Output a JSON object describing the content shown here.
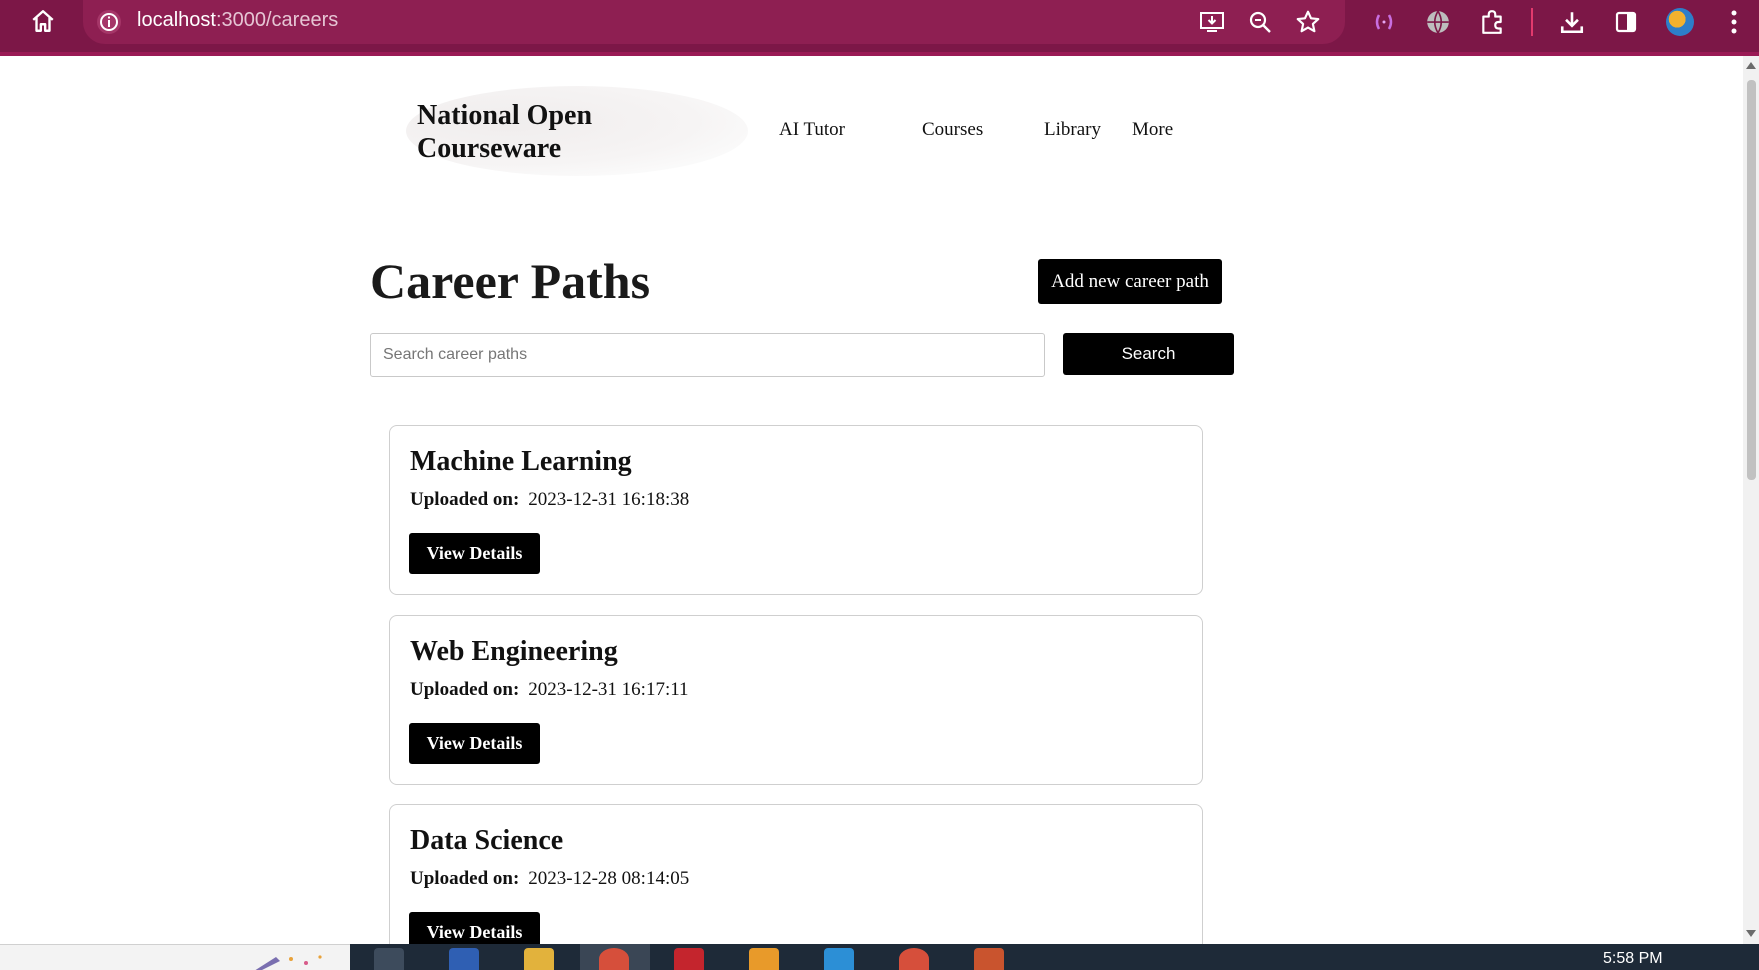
{
  "browser": {
    "url_host": "localhost",
    "url_path": ":3000/careers"
  },
  "site": {
    "brand_line1": "National Open",
    "brand_line2": "Courseware",
    "nav": [
      "AI Tutor",
      "Courses",
      "Library",
      "More"
    ]
  },
  "page": {
    "title": "Career Paths",
    "add_button": "Add new career path",
    "search_placeholder": "Search career paths",
    "search_button": "Search"
  },
  "careers": [
    {
      "title": "Machine Learning",
      "uploaded_label": "Uploaded on:",
      "uploaded_on": "2023-12-31 16:18:38",
      "button": "View Details"
    },
    {
      "title": "Web Engineering",
      "uploaded_label": "Uploaded on:",
      "uploaded_on": "2023-12-31 16:17:11",
      "button": "View Details"
    },
    {
      "title": "Data Science",
      "uploaded_label": "Uploaded on:",
      "uploaded_on": "2023-12-28 08:14:05",
      "button": "View Details"
    }
  ],
  "taskbar": {
    "clock": "5:58 PM"
  },
  "colors": {
    "chrome_bg": "#7c1747",
    "omnibox_bg": "#8e1f52",
    "button_bg": "#000000",
    "card_border": "#cfcfcf"
  }
}
